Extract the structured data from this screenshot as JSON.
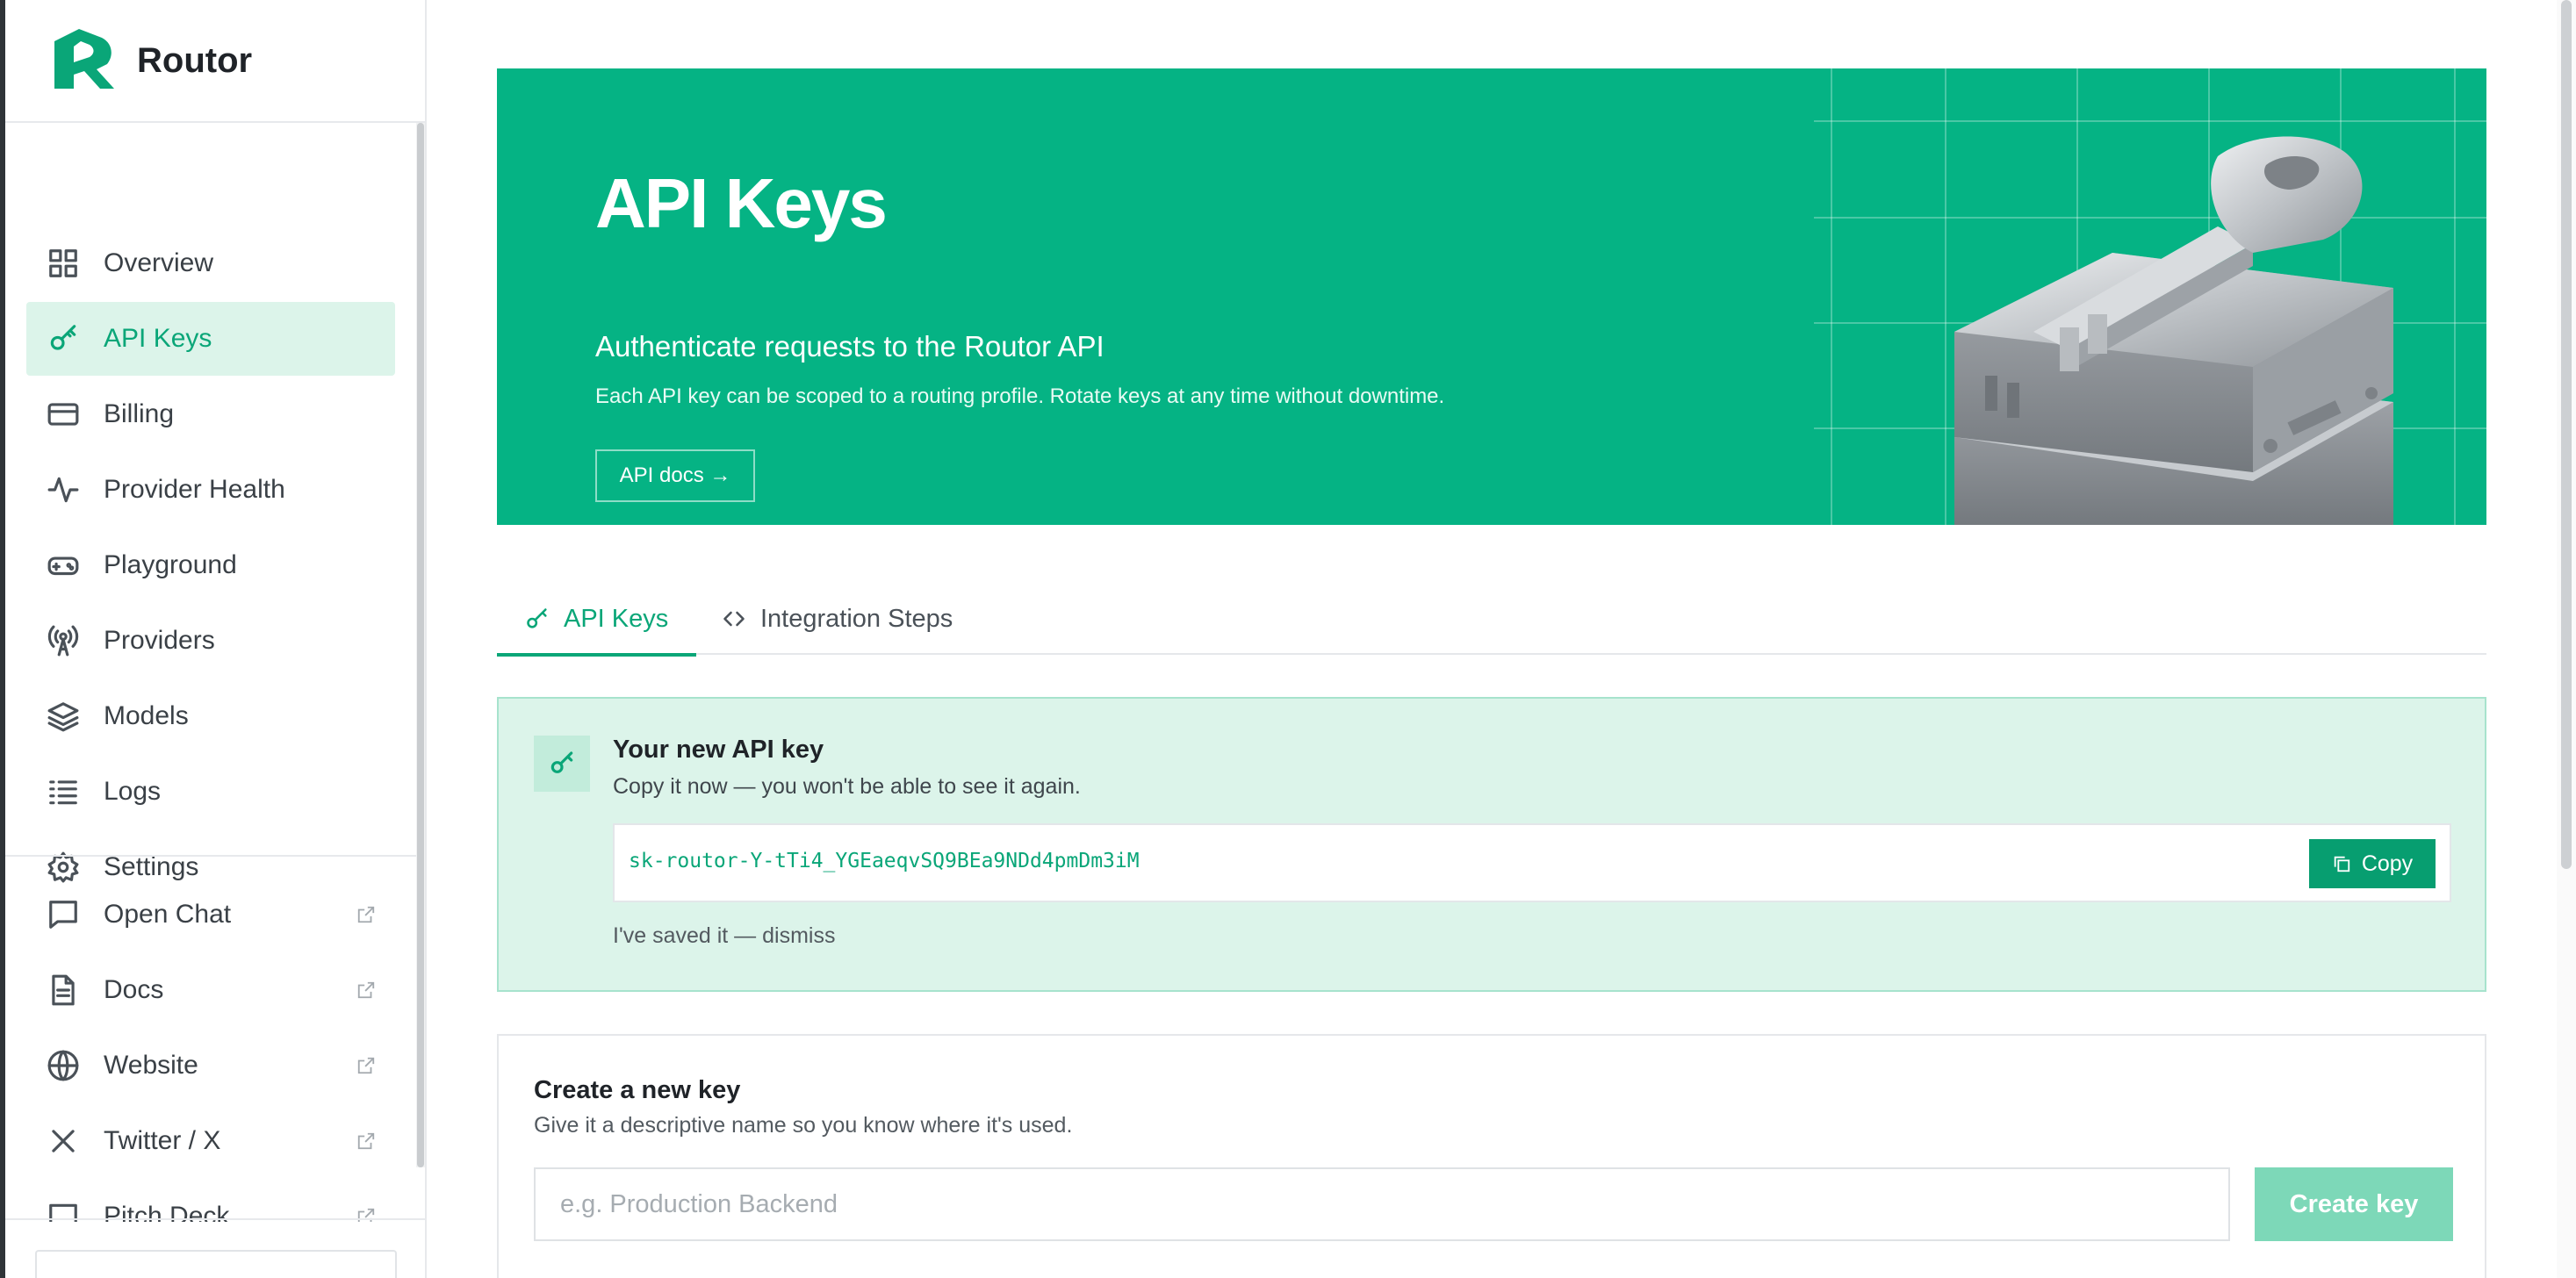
{
  "app": {
    "name": "Routor"
  },
  "sidebar": {
    "items": [
      {
        "label": "Overview",
        "icon": "grid-icon"
      },
      {
        "label": "API Keys",
        "icon": "key-icon",
        "active": true
      },
      {
        "label": "Billing",
        "icon": "credit-card-icon"
      },
      {
        "label": "Provider Health",
        "icon": "activity-icon"
      },
      {
        "label": "Playground",
        "icon": "gamepad-icon"
      },
      {
        "label": "Providers",
        "icon": "broadcast-icon"
      },
      {
        "label": "Models",
        "icon": "layers-icon"
      },
      {
        "label": "Logs",
        "icon": "list-icon"
      },
      {
        "label": "Settings",
        "icon": "gear-icon"
      }
    ],
    "external": [
      {
        "label": "Open Chat",
        "icon": "chat-icon"
      },
      {
        "label": "Docs",
        "icon": "document-icon"
      },
      {
        "label": "Website",
        "icon": "globe-icon"
      },
      {
        "label": "Twitter / X",
        "icon": "x-icon"
      },
      {
        "label": "Pitch Deck",
        "icon": "presentation-icon"
      }
    ]
  },
  "hero": {
    "title": "API Keys",
    "subtitle": "Authenticate requests to the Routor API",
    "description": "Each API key can be scoped to a routing profile. Rotate keys at any time without downtime.",
    "docs_label": "API docs →"
  },
  "tabs": [
    {
      "label": "API Keys",
      "icon": "key-icon",
      "active": true
    },
    {
      "label": "Integration Steps",
      "icon": "code-icon"
    }
  ],
  "new_key": {
    "title": "Your new API key",
    "hint": "Copy it now — you won't be able to see it again.",
    "value": "sk-routor-Y-tTi4_YGEaeqvSQ9BEa9NDd4pmDm3iM",
    "copy_label": "Copy",
    "dismiss_label": "I've saved it — dismiss"
  },
  "create_key": {
    "title": "Create a new key",
    "hint": "Give it a descriptive name so you know where it's used.",
    "placeholder": "e.g. Production Backend",
    "value": "",
    "button_label": "Create key"
  },
  "colors": {
    "accent": "#05b384",
    "accent_dark": "#0aa678",
    "accent_light": "#dcf4ea"
  }
}
